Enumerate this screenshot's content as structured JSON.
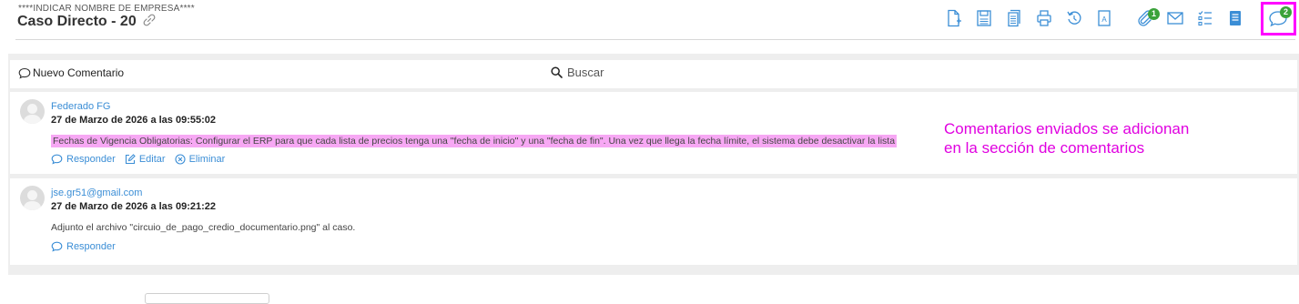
{
  "header": {
    "company": "****INDICAR NOMBRE DE EMPRESA****",
    "case_title": "Caso Directo - 20",
    "accent": "#3b8ed6",
    "toolbar": [
      {
        "name": "new-document-icon",
        "badge": ""
      },
      {
        "name": "save-icon",
        "badge": ""
      },
      {
        "name": "document-list-icon",
        "badge": ""
      },
      {
        "name": "print-icon",
        "badge": ""
      },
      {
        "name": "history-icon",
        "badge": ""
      },
      {
        "name": "text-document-icon",
        "badge": ""
      },
      {
        "name": "attachment-icon",
        "badge": "1"
      },
      {
        "name": "email-icon",
        "badge": ""
      },
      {
        "name": "checklist-icon",
        "badge": ""
      },
      {
        "name": "notes-icon",
        "badge": ""
      },
      {
        "name": "comments-icon",
        "badge": "2"
      }
    ],
    "badge_color": "#3aa23a",
    "highlight_color": "#ff00ff"
  },
  "comments_panel": {
    "new_comment_label": "Nuevo Comentario",
    "search_placeholder": "Buscar",
    "comments": [
      {
        "author": "Federado FG",
        "date": "27 de Marzo de 2026 a las 09:55:02",
        "text": "Fechas de Vigencia Obligatorias: Configurar el ERP para que cada lista de precios tenga una \"fecha de inicio\" y una \"fecha de fin\". Una vez que llega la fecha límite, el sistema debe desactivar la lista",
        "actions": [
          "Responder",
          "Editar",
          "Eliminar"
        ]
      },
      {
        "author": "jse.gr51@gmail.com",
        "date": "27 de Marzo de 2026 a las 09:21:22",
        "text": "Adjunto el archivo \"circuio_de_pago_credio_documentario.png\" al caso.",
        "actions": [
          "Responder"
        ]
      }
    ]
  },
  "annotation": {
    "line1": "Comentarios enviados se adicionan",
    "line2": "en la sección de comentarios",
    "color": "#e000e0"
  }
}
